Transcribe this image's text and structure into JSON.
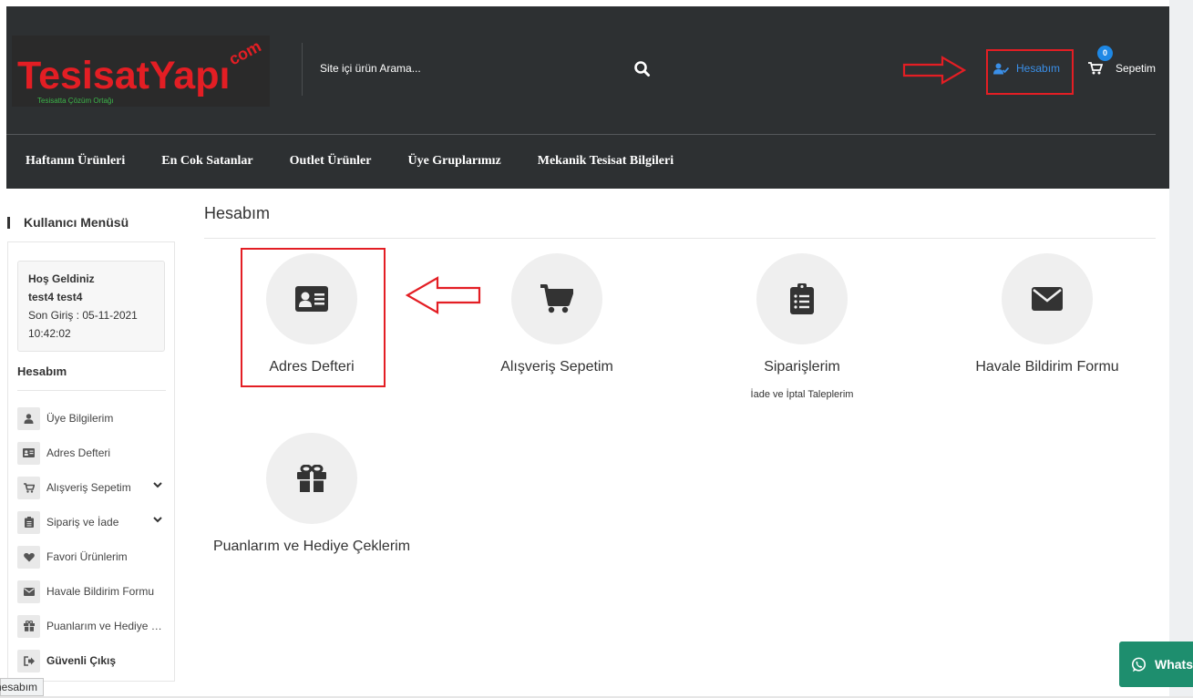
{
  "header": {
    "logo_main": "TesisatYapı",
    "logo_com": "com",
    "logo_tagline": "Tesisatta Çözüm Ortağı",
    "search_placeholder": "Site içi ürün Arama...",
    "account_label": "Hesabım",
    "cart_label": "Sepetim",
    "cart_count": "0",
    "nav": [
      "Haftanın Ürünleri",
      "En Cok Satanlar",
      "Outlet Ürünler",
      "Üye Gruplarımız",
      "Mekanik Tesisat Bilgileri"
    ]
  },
  "sidebar": {
    "title": "Kullanıcı Menüsü",
    "welcome_line1": "Hoş Geldiniz",
    "welcome_line2": "test4 test4",
    "last_login_line1": "Son Giriş : 05-11-2021",
    "last_login_line2": "10:42:02",
    "section_title": "Hesabım",
    "items": [
      {
        "label": "Üye Bilgilerim",
        "icon": "user-icon"
      },
      {
        "label": "Adres Defteri",
        "icon": "address-card-icon"
      },
      {
        "label": "Alışveriş Sepetim",
        "icon": "cart-icon"
      },
      {
        "label": "Sipariş ve İade",
        "icon": "clipboard-icon"
      },
      {
        "label": "Favori Ürünlerim",
        "icon": "heart-icon"
      },
      {
        "label": "Havale Bildirim Formu",
        "icon": "envelope-icon"
      },
      {
        "label": "Puanlarım ve Hediye Çeklerim",
        "icon": "gift-icon"
      },
      {
        "label": "Güvenli Çıkış",
        "icon": "sign-out-icon"
      }
    ]
  },
  "main": {
    "title": "Hesabım",
    "cards": [
      {
        "label": "Adres Defteri",
        "icon": "address-card-icon"
      },
      {
        "label": "Alışveriş Sepetim",
        "icon": "cart-icon"
      },
      {
        "label": "Siparişlerim",
        "sub": "İade ve İptal Taleplerim",
        "icon": "clipboard-icon"
      },
      {
        "label": "Havale Bildirim Formu",
        "icon": "envelope-icon"
      },
      {
        "label": "Puanlarım ve Hediye Çeklerim",
        "icon": "gift-icon"
      }
    ]
  },
  "status_tooltip": "hesabım",
  "whatsapp_label": "Whats",
  "colors": {
    "header_bg": "#2d3032",
    "accent_red": "#e31e24",
    "link_blue": "#3a8fe8",
    "whatsapp_green": "#1e8e6e"
  }
}
